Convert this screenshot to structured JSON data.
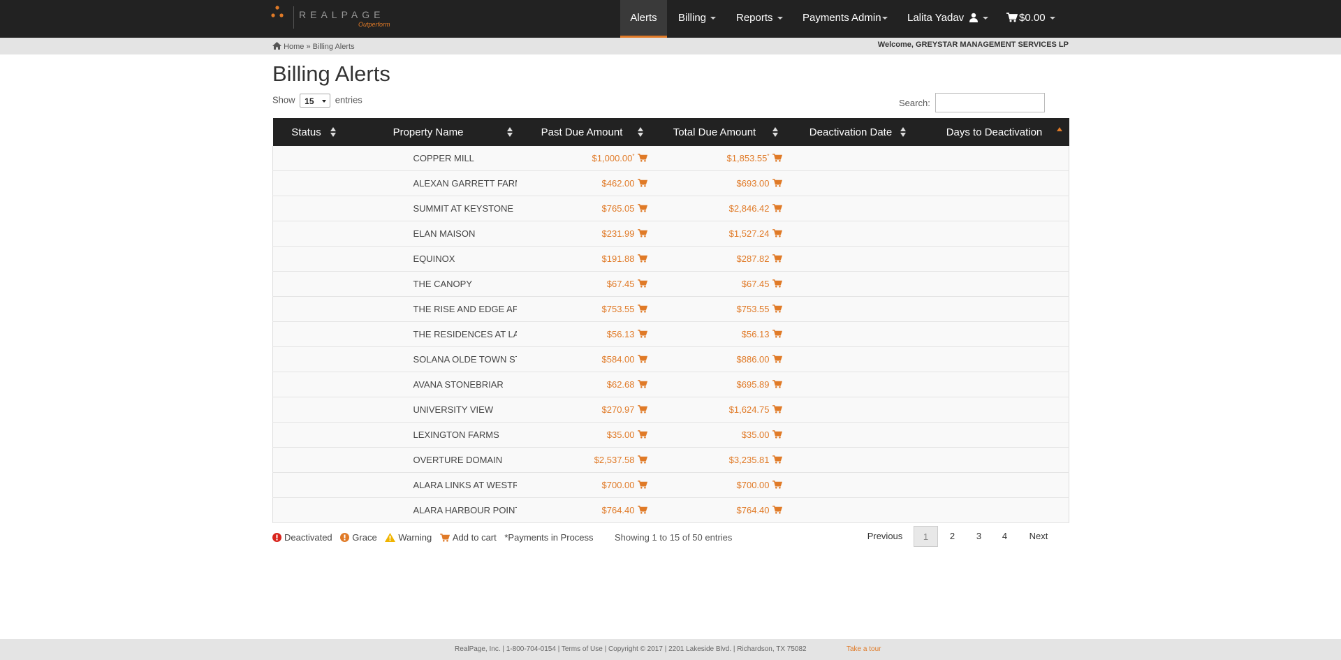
{
  "brand": {
    "name": "REALPAGE",
    "tagline": "Outperform"
  },
  "nav": {
    "alerts": "Alerts",
    "billing": "Billing",
    "reports": "Reports",
    "payments_admin": "Payments Admin",
    "user": "Lalita Yadav",
    "cart_total": "$0.00"
  },
  "breadcrumb": {
    "home": "Home",
    "sep": "»",
    "current": "Billing Alerts"
  },
  "welcome": "Welcome, GREYSTAR MANAGEMENT SERVICES LP",
  "page_title": "Billing Alerts",
  "length": {
    "show": "Show",
    "value": "15",
    "entries": "entries"
  },
  "search": {
    "label": "Search:",
    "value": ""
  },
  "table": {
    "headers": {
      "status": "Status",
      "property": "Property Name",
      "past_due": "Past Due Amount",
      "total_due": "Total Due Amount",
      "deactivation_date": "Deactivation Date",
      "days": "Days to Deactivation"
    },
    "rows": [
      {
        "property": "COPPER MILL",
        "past_due": "$1,000.00",
        "total_due": "$1,853.55",
        "past_due_mark": "*",
        "total_due_mark": "*"
      },
      {
        "property": "ALEXAN GARRETT FARMS...",
        "past_due": "$462.00",
        "total_due": "$693.00"
      },
      {
        "property": "SUMMIT AT KEYSTONE",
        "past_due": "$765.05",
        "total_due": "$2,846.42"
      },
      {
        "property": "ELAN MAISON",
        "past_due": "$231.99",
        "total_due": "$1,527.24"
      },
      {
        "property": "EQUINOX",
        "past_due": "$191.88",
        "total_due": "$287.82"
      },
      {
        "property": "THE CANOPY",
        "past_due": "$67.45",
        "total_due": "$67.45"
      },
      {
        "property": "THE RISE AND EDGE AP...",
        "past_due": "$753.55",
        "total_due": "$753.55"
      },
      {
        "property": "THE RESIDENCES AT LA...",
        "past_due": "$56.13",
        "total_due": "$56.13"
      },
      {
        "property": "SOLANA OLDE TOWN STATION",
        "past_due": "$584.00",
        "total_due": "$886.00"
      },
      {
        "property": "AVANA STONEBRIAR",
        "past_due": "$62.68",
        "total_due": "$695.89"
      },
      {
        "property": "UNIVERSITY VIEW",
        "past_due": "$270.97",
        "total_due": "$1,624.75"
      },
      {
        "property": "LEXINGTON FARMS",
        "past_due": "$35.00",
        "total_due": "$35.00"
      },
      {
        "property": "OVERTURE DOMAIN",
        "past_due": "$2,537.58",
        "total_due": "$3,235.81"
      },
      {
        "property": "ALARA LINKS AT WESTR...",
        "past_due": "$700.00",
        "total_due": "$700.00"
      },
      {
        "property": "ALARA HARBOUR POINTE",
        "past_due": "$764.40",
        "total_due": "$764.40"
      }
    ]
  },
  "legend": {
    "deactivated": "Deactivated",
    "grace": "Grace",
    "warning": "Warning",
    "add_to_cart": "Add to cart",
    "payments": "*Payments in Process"
  },
  "info": "Showing 1 to 15 of 50 entries",
  "pagination": {
    "previous": "Previous",
    "pages": [
      "1",
      "2",
      "3",
      "4"
    ],
    "next": "Next"
  },
  "footer": {
    "text": "RealPage, Inc. | 1-800-704-0154 | Terms of Use | Copyright © 2017 | 2201 Lakeside Blvd. | Richardson, TX 75082",
    "tour": "Take a tour"
  },
  "colors": {
    "accent": "#e07a27",
    "navbar": "#222222",
    "danger": "#d9251d",
    "grace": "#e07a27",
    "warning": "#f0b400"
  },
  "icons": [
    "home-icon",
    "user-icon",
    "cart-icon",
    "sort-icon",
    "deactivated-icon",
    "grace-icon",
    "warning-icon"
  ]
}
